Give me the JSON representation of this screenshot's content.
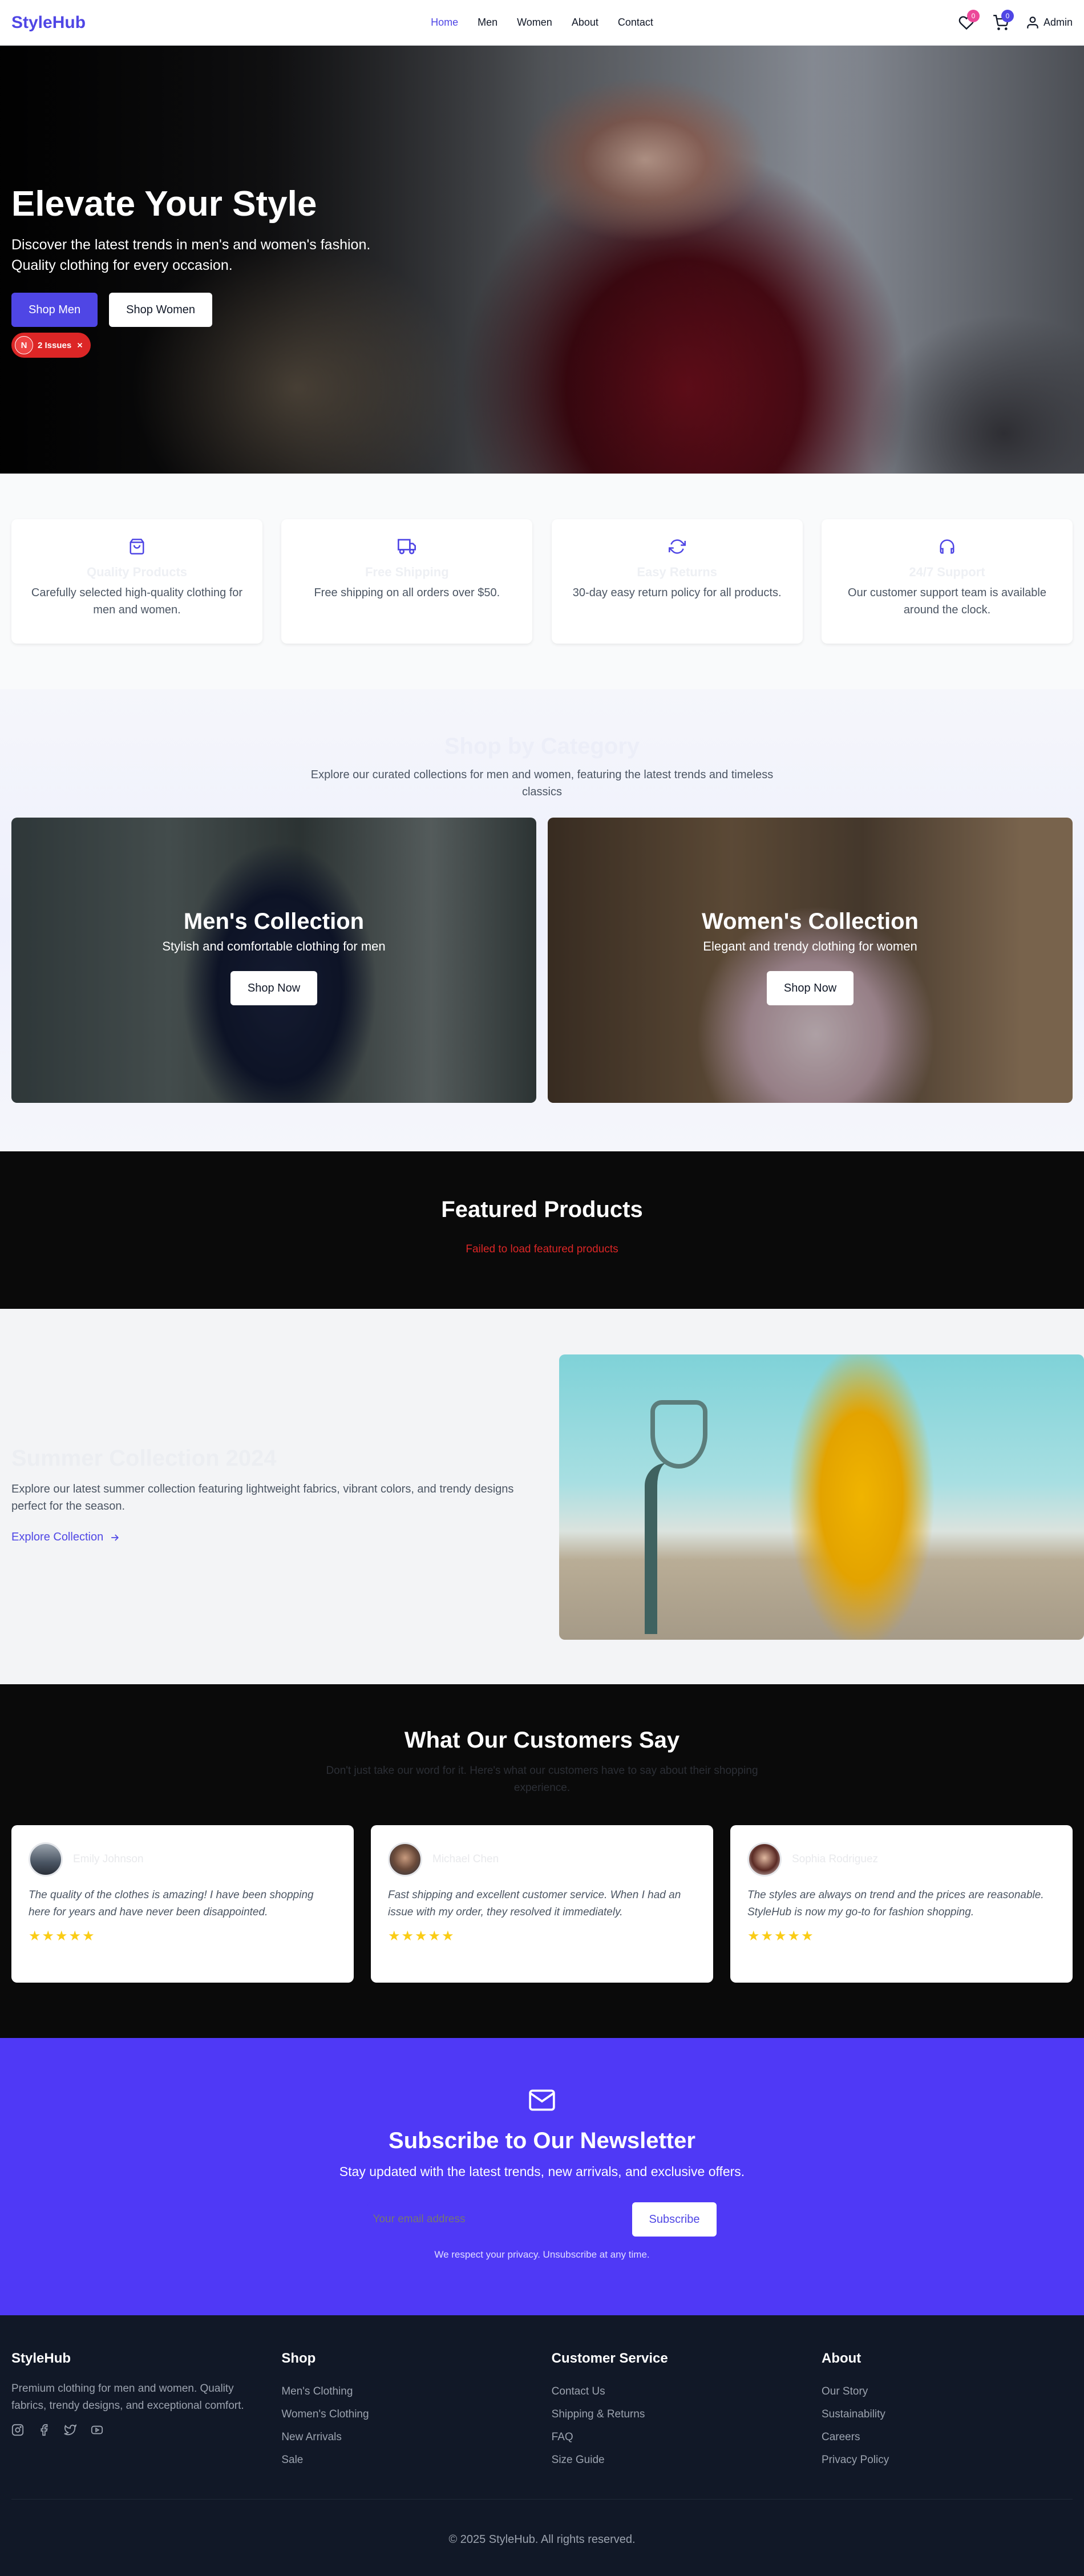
{
  "nav": {
    "logo": "StyleHub",
    "links": [
      "Home",
      "Men",
      "Women",
      "About",
      "Contact"
    ],
    "active": "Home",
    "wishlist_count": "0",
    "cart_count": "0",
    "user_label": "Admin",
    "icons": [
      "heart-icon",
      "cart-icon",
      "user-icon"
    ]
  },
  "hero": {
    "title": "Elevate Your Style",
    "subtitle_line1": "Discover the latest trends in men's and women's fashion.",
    "subtitle_line2": "Quality clothing for every occasion.",
    "btn_men": "Shop Men",
    "btn_women": "Shop Women",
    "issue_letter": "N",
    "issue_text": "2 Issues"
  },
  "features": [
    {
      "icon": "shopping-bag-icon",
      "title": "Quality Products",
      "desc": "Carefully selected high-quality clothing for men and women."
    },
    {
      "icon": "truck-icon",
      "title": "Free Shipping",
      "desc": "Free shipping on all orders over $50."
    },
    {
      "icon": "refresh-icon",
      "title": "Easy Returns",
      "desc": "30-day easy return policy for all products."
    },
    {
      "icon": "headphones-icon",
      "title": "24/7 Support",
      "desc": "Our customer support team is available around the clock."
    }
  ],
  "category": {
    "title": "Shop by Category",
    "subtitle": "Explore our curated collections for men and women, featuring the latest trends and timeless classics",
    "men": {
      "name": "Men's Collection",
      "desc": "Stylish and comfortable clothing for men",
      "btn": "Shop Now"
    },
    "women": {
      "name": "Women's Collection",
      "desc": "Elegant and trendy clothing for women",
      "btn": "Shop Now"
    }
  },
  "featured": {
    "title": "Featured Products",
    "error": "Failed to load featured products"
  },
  "summer": {
    "title": "Summer Collection 2024",
    "desc": "Explore our latest summer collection featuring lightweight fabrics, vibrant colors, and trendy designs perfect for the season.",
    "link": "Explore Collection"
  },
  "testimonials": {
    "title": "What Our Customers Say",
    "subtitle": "Don't just take our word for it. Here's what our customers have to say about their shopping experience.",
    "items": [
      {
        "name": "Emily Johnson",
        "quote": "The quality of the clothes is amazing! I have been shopping here for years and have never been disappointed.",
        "stars": "★★★★★",
        "rating": 5
      },
      {
        "name": "Michael Chen",
        "quote": "Fast shipping and excellent customer service. When I had an issue with my order, they resolved it immediately.",
        "stars": "★★★★★",
        "rating": 5
      },
      {
        "name": "Sophia Rodriguez",
        "quote": "The styles are always on trend and the prices are reasonable. StyleHub is now my go-to for fashion shopping.",
        "stars": "★★★★★",
        "rating": 5
      }
    ]
  },
  "newsletter": {
    "title": "Subscribe to Our Newsletter",
    "subtitle": "Stay updated with the latest trends, new arrivals, and exclusive offers.",
    "placeholder": "Your email address",
    "button": "Subscribe",
    "note": "We respect your privacy. Unsubscribe at any time."
  },
  "footer": {
    "brand": "StyleHub",
    "brand_desc": "Premium clothing for men and women. Quality fabrics, trendy designs, and exceptional comfort.",
    "social_icons": [
      "instagram-icon",
      "facebook-icon",
      "twitter-icon",
      "youtube-icon"
    ],
    "shop": {
      "title": "Shop",
      "items": [
        "Men's Clothing",
        "Women's Clothing",
        "New Arrivals",
        "Sale"
      ]
    },
    "service": {
      "title": "Customer Service",
      "items": [
        "Contact Us",
        "Shipping & Returns",
        "FAQ",
        "Size Guide"
      ]
    },
    "about": {
      "title": "About",
      "items": [
        "Our Story",
        "Sustainability",
        "Careers",
        "Privacy Policy"
      ]
    },
    "copyright": "© 2025 StyleHub. All rights reserved."
  },
  "colors": {
    "brand": "#4f46e5",
    "newsletter_bg": "#4f39f6",
    "dark_section": "#0a0a0a",
    "footer_bg": "#111827",
    "error": "#dc2626",
    "star": "#facc15"
  }
}
